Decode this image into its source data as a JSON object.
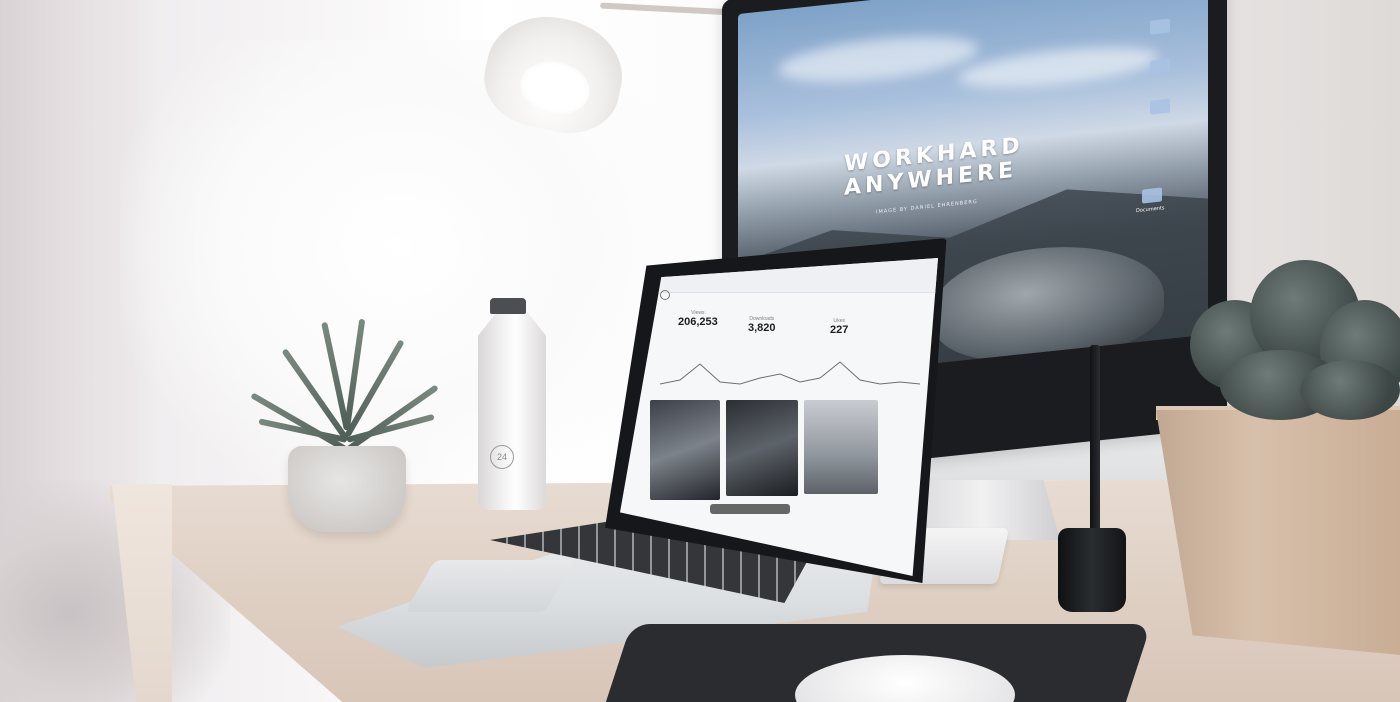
{
  "scene": {
    "monitor": {
      "hero_title_line1": "WORKHARD",
      "hero_title_line2": "ANYWHERE",
      "hero_caption": "IMAGE BY DANIEL EHRENBERG",
      "desktop_icon_label": "Documents"
    },
    "laptop": {
      "stats": [
        {
          "label": "Views",
          "value": "206,253"
        },
        {
          "label": "Downloads",
          "value": "3,820"
        },
        {
          "label": "Likes",
          "value": "227"
        }
      ]
    },
    "bottle": {
      "logo_text": "24"
    }
  },
  "colors": {
    "desk": "#e0d1c5",
    "monitor_sky": "#a9c0dc",
    "planter_wood": "#d7c0ab"
  }
}
